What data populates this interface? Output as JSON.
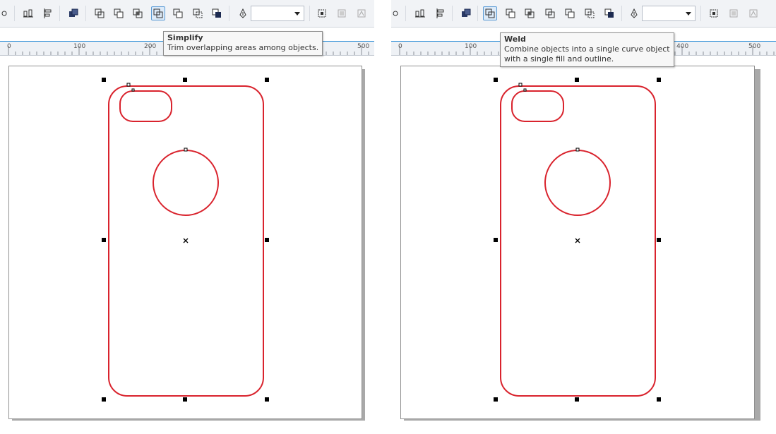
{
  "colors": {
    "shape_outline": "#d9232d",
    "active_button_border": "#5b9bd5",
    "ruler_accent": "#2f8fd6",
    "toolbar_bg": "#f1f3f6"
  },
  "toolbar": {
    "buttons": [
      {
        "name": "object-origin-icon"
      },
      {
        "name": "align-icon"
      },
      {
        "name": "distribute-icon"
      },
      {
        "name": "combine-icon"
      },
      {
        "name": "weld-icon",
        "label": "Weld"
      },
      {
        "name": "trim-icon"
      },
      {
        "name": "intersect-icon"
      },
      {
        "name": "simplify-icon",
        "label": "Simplify"
      },
      {
        "name": "front-minus-back-icon"
      },
      {
        "name": "back-minus-front-icon"
      },
      {
        "name": "create-boundary-icon"
      },
      {
        "name": "outline-pen-icon"
      },
      {
        "name": "select-all-nodes-icon"
      },
      {
        "name": "bitmap-icon"
      },
      {
        "name": "trace-icon"
      }
    ],
    "outline_width_value": ""
  },
  "panels": [
    {
      "id": "left",
      "active_button": "simplify-icon",
      "ruler_labels": [
        "0",
        "100",
        "200",
        "500"
      ],
      "tooltip": {
        "title": "Simplify",
        "lines": [
          "Trim overlapping areas among objects."
        ]
      }
    },
    {
      "id": "right",
      "active_button": "weld-icon",
      "ruler_labels": [
        "0",
        "100",
        "400",
        "500"
      ],
      "tooltip": {
        "title": "Weld",
        "lines": [
          "Combine objects into a single curve object",
          "with a single fill and outline."
        ]
      }
    }
  ]
}
